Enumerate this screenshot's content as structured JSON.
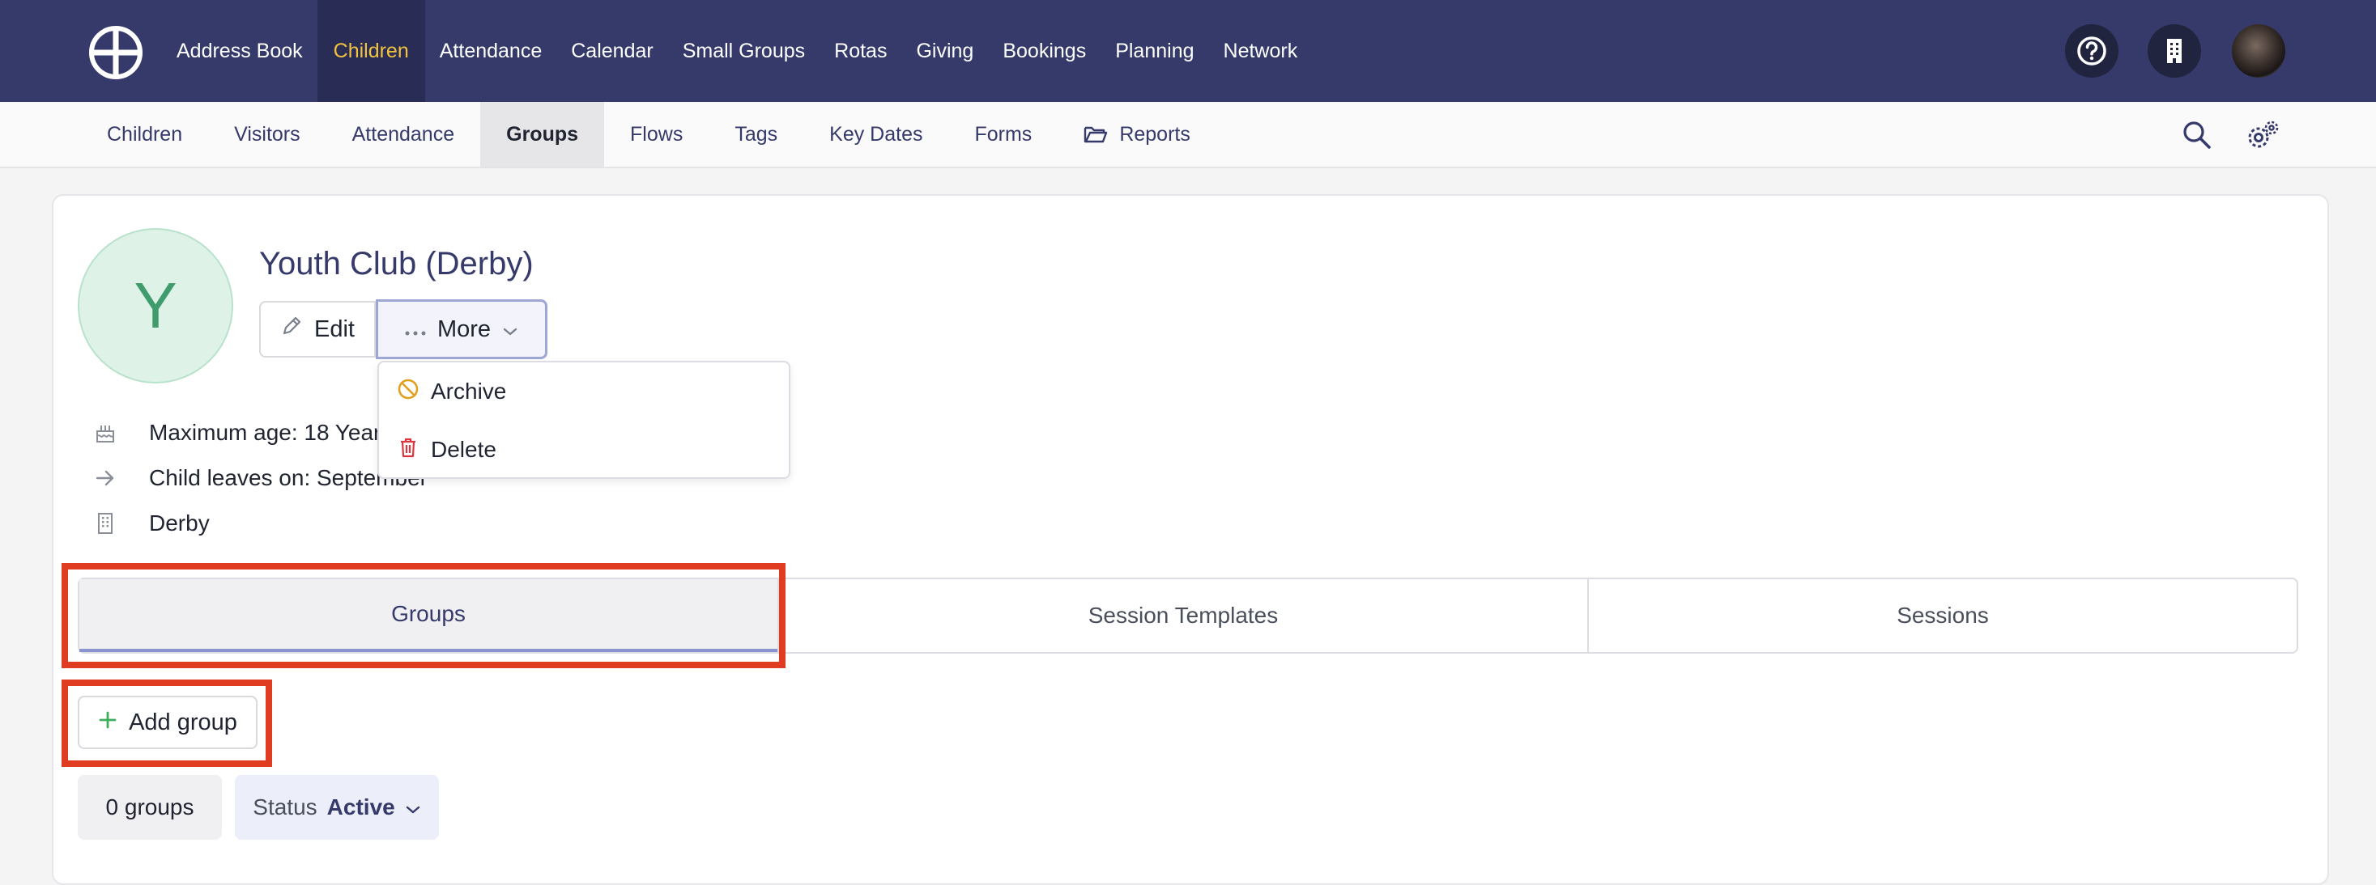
{
  "colors": {
    "topnav_bg": "#353a6b",
    "active_nav_text": "#f2c23e",
    "highlight_border": "#e03c22",
    "avatar_bg": "#def2e8",
    "avatar_text": "#3f9c6c",
    "archive_icon": "#e0a020",
    "delete_icon": "#d9363e",
    "add_icon": "#3fae5c"
  },
  "topnav": {
    "logo_icon": "wheel-logo-icon",
    "items": [
      {
        "label": "Address Book"
      },
      {
        "label": "Children",
        "active": true
      },
      {
        "label": "Attendance"
      },
      {
        "label": "Calendar"
      },
      {
        "label": "Small Groups"
      },
      {
        "label": "Rotas"
      },
      {
        "label": "Giving"
      },
      {
        "label": "Bookings"
      },
      {
        "label": "Planning"
      },
      {
        "label": "Network"
      }
    ],
    "right_icons": [
      "help-icon",
      "building-icon",
      "user-avatar"
    ]
  },
  "subnav": {
    "items": [
      {
        "label": "Children"
      },
      {
        "label": "Visitors"
      },
      {
        "label": "Attendance"
      },
      {
        "label": "Groups",
        "active": true
      },
      {
        "label": "Flows"
      },
      {
        "label": "Tags"
      },
      {
        "label": "Key Dates"
      },
      {
        "label": "Forms"
      },
      {
        "label": "Reports",
        "icon": "folder-open-icon"
      }
    ],
    "right_icons": [
      "search-icon",
      "settings-gears-icon"
    ]
  },
  "group": {
    "avatar_letter": "Y",
    "title": "Youth Club (Derby)",
    "edit_label": "Edit",
    "more_label": "More",
    "more_menu": [
      {
        "label": "Archive",
        "icon": "archive-ban-icon"
      },
      {
        "label": "Delete",
        "icon": "trash-icon"
      }
    ],
    "info": [
      {
        "icon": "cake-icon",
        "text": "Maximum age: 18 Years"
      },
      {
        "icon": "arrow-right-icon",
        "text": "Child leaves on: September"
      },
      {
        "icon": "building-icon",
        "text": "Derby"
      }
    ]
  },
  "tabs": [
    {
      "label": "Groups",
      "active": true
    },
    {
      "label": "Session Templates"
    },
    {
      "label": "Sessions"
    }
  ],
  "add_group_label": "Add group",
  "groups_count": "0 groups",
  "status_filter": {
    "label": "Status",
    "value": "Active"
  }
}
